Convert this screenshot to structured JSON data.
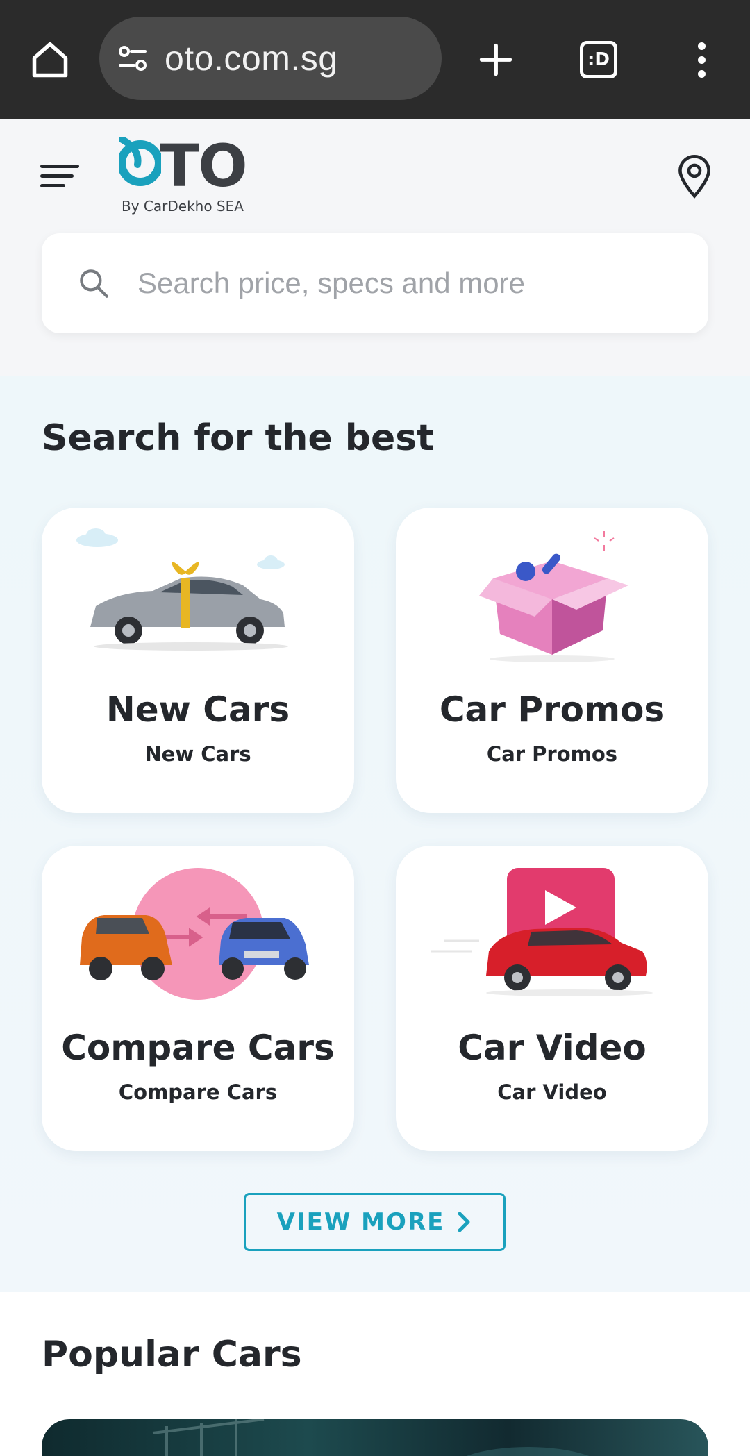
{
  "browser": {
    "url": "oto.com.sg",
    "tab_count_label": ":D"
  },
  "header": {
    "logo_text": "OTO",
    "logo_tagline": "By CarDekho SEA",
    "search_placeholder": "Search price, specs and more"
  },
  "categories": {
    "title": "Search for the best",
    "cards": [
      {
        "title": "New Cars",
        "subtitle": "New Cars"
      },
      {
        "title": "Car Promos",
        "subtitle": "Car Promos"
      },
      {
        "title": "Compare Cars",
        "subtitle": "Compare Cars"
      },
      {
        "title": "Car Video",
        "subtitle": "Car Video"
      }
    ],
    "view_more_label": "VIEW MORE"
  },
  "popular": {
    "title": "Popular Cars"
  },
  "colors": {
    "accent": "#1aa1bd",
    "chrome_bg": "#2b2b2b",
    "text": "#24272c"
  }
}
